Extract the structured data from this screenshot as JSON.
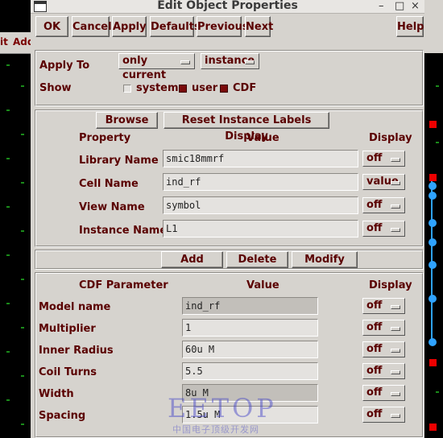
{
  "window": {
    "title": "Edit Object Properties",
    "minimize_glyph": "–",
    "maximize_glyph": "□",
    "close_glyph": "×"
  },
  "background": {
    "fragment_left_1": "it",
    "fragment_left_2": "Add"
  },
  "toolbar": {
    "ok": "OK",
    "cancel": "Cancel",
    "apply": "Apply",
    "defaults": "Defaults",
    "previous": "Previous",
    "next": "Next",
    "help": "Help"
  },
  "apply_section": {
    "apply_to_label": "Apply To",
    "apply_to_value1": "only current",
    "apply_to_value2": "instance",
    "show_label": "Show",
    "system_label": "system",
    "system_checked": false,
    "user_label": "user",
    "user_checked": true,
    "cdf_label": "CDF",
    "cdf_checked": true
  },
  "instance_section": {
    "browse": "Browse",
    "reset_labels": "Reset Instance Labels Display",
    "headers": {
      "property": "Property",
      "value": "Value",
      "display": "Display"
    },
    "rows": [
      {
        "label": "Library Name",
        "value": "smic18mmrf",
        "display": "off"
      },
      {
        "label": "Cell Name",
        "value": "ind_rf",
        "display": "value"
      },
      {
        "label": "View Name",
        "value": "symbol",
        "display": "off"
      },
      {
        "label": "Instance Name",
        "value": "L1",
        "display": "off"
      }
    ]
  },
  "actions": {
    "add": "Add",
    "delete": "Delete",
    "modify": "Modify"
  },
  "cdf_section": {
    "headers": {
      "parameter": "CDF Parameter",
      "value": "Value",
      "display": "Display"
    },
    "rows": [
      {
        "label": "Model name",
        "value": "ind_rf",
        "display": "off",
        "readonly": true
      },
      {
        "label": "Multiplier",
        "value": "1",
        "display": "off",
        "readonly": false
      },
      {
        "label": "Inner Radius",
        "value": "60u M",
        "display": "off",
        "readonly": false
      },
      {
        "label": "Coil Turns",
        "value": "5.5",
        "display": "off",
        "readonly": false
      },
      {
        "label": "Width",
        "value": "8u M",
        "display": "off",
        "readonly": true
      },
      {
        "label": "Spacing",
        "value": "1.5u M",
        "display": "off",
        "readonly": false
      }
    ]
  },
  "watermark": {
    "text": "EETOP",
    "subtext": "中国电子顶级开发网"
  },
  "colors": {
    "label_text": "#5a0000",
    "checkbox_on": "#7a0a0a",
    "dialog_bg": "#d6d3ce",
    "field_bg": "#e4e2df",
    "readonly_bg": "#c2bfba"
  }
}
